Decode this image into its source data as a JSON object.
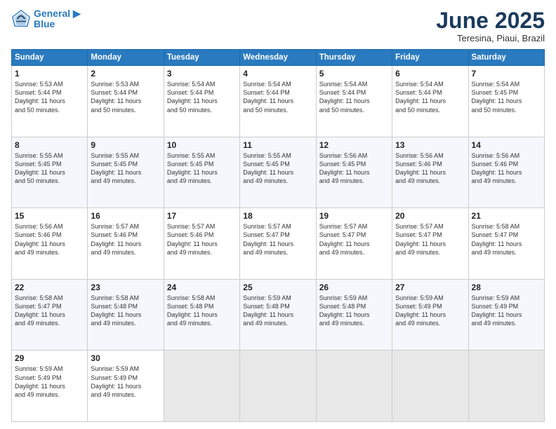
{
  "header": {
    "logo_line1": "General",
    "logo_line2": "Blue",
    "title": "June 2025",
    "subtitle": "Teresina, Piaui, Brazil"
  },
  "days_of_week": [
    "Sunday",
    "Monday",
    "Tuesday",
    "Wednesday",
    "Thursday",
    "Friday",
    "Saturday"
  ],
  "weeks": [
    [
      {
        "day": "1",
        "info": "Sunrise: 5:53 AM\nSunset: 5:44 PM\nDaylight: 11 hours\nand 50 minutes."
      },
      {
        "day": "2",
        "info": "Sunrise: 5:53 AM\nSunset: 5:44 PM\nDaylight: 11 hours\nand 50 minutes."
      },
      {
        "day": "3",
        "info": "Sunrise: 5:54 AM\nSunset: 5:44 PM\nDaylight: 11 hours\nand 50 minutes."
      },
      {
        "day": "4",
        "info": "Sunrise: 5:54 AM\nSunset: 5:44 PM\nDaylight: 11 hours\nand 50 minutes."
      },
      {
        "day": "5",
        "info": "Sunrise: 5:54 AM\nSunset: 5:44 PM\nDaylight: 11 hours\nand 50 minutes."
      },
      {
        "day": "6",
        "info": "Sunrise: 5:54 AM\nSunset: 5:44 PM\nDaylight: 11 hours\nand 50 minutes."
      },
      {
        "day": "7",
        "info": "Sunrise: 5:54 AM\nSunset: 5:45 PM\nDaylight: 11 hours\nand 50 minutes."
      }
    ],
    [
      {
        "day": "8",
        "info": "Sunrise: 5:55 AM\nSunset: 5:45 PM\nDaylight: 11 hours\nand 50 minutes."
      },
      {
        "day": "9",
        "info": "Sunrise: 5:55 AM\nSunset: 5:45 PM\nDaylight: 11 hours\nand 49 minutes."
      },
      {
        "day": "10",
        "info": "Sunrise: 5:55 AM\nSunset: 5:45 PM\nDaylight: 11 hours\nand 49 minutes."
      },
      {
        "day": "11",
        "info": "Sunrise: 5:55 AM\nSunset: 5:45 PM\nDaylight: 11 hours\nand 49 minutes."
      },
      {
        "day": "12",
        "info": "Sunrise: 5:56 AM\nSunset: 5:45 PM\nDaylight: 11 hours\nand 49 minutes."
      },
      {
        "day": "13",
        "info": "Sunrise: 5:56 AM\nSunset: 5:46 PM\nDaylight: 11 hours\nand 49 minutes."
      },
      {
        "day": "14",
        "info": "Sunrise: 5:56 AM\nSunset: 5:46 PM\nDaylight: 11 hours\nand 49 minutes."
      }
    ],
    [
      {
        "day": "15",
        "info": "Sunrise: 5:56 AM\nSunset: 5:46 PM\nDaylight: 11 hours\nand 49 minutes."
      },
      {
        "day": "16",
        "info": "Sunrise: 5:57 AM\nSunset: 5:46 PM\nDaylight: 11 hours\nand 49 minutes."
      },
      {
        "day": "17",
        "info": "Sunrise: 5:57 AM\nSunset: 5:46 PM\nDaylight: 11 hours\nand 49 minutes."
      },
      {
        "day": "18",
        "info": "Sunrise: 5:57 AM\nSunset: 5:47 PM\nDaylight: 11 hours\nand 49 minutes."
      },
      {
        "day": "19",
        "info": "Sunrise: 5:57 AM\nSunset: 5:47 PM\nDaylight: 11 hours\nand 49 minutes."
      },
      {
        "day": "20",
        "info": "Sunrise: 5:57 AM\nSunset: 5:47 PM\nDaylight: 11 hours\nand 49 minutes."
      },
      {
        "day": "21",
        "info": "Sunrise: 5:58 AM\nSunset: 5:47 PM\nDaylight: 11 hours\nand 49 minutes."
      }
    ],
    [
      {
        "day": "22",
        "info": "Sunrise: 5:58 AM\nSunset: 5:47 PM\nDaylight: 11 hours\nand 49 minutes."
      },
      {
        "day": "23",
        "info": "Sunrise: 5:58 AM\nSunset: 5:48 PM\nDaylight: 11 hours\nand 49 minutes."
      },
      {
        "day": "24",
        "info": "Sunrise: 5:58 AM\nSunset: 5:48 PM\nDaylight: 11 hours\nand 49 minutes."
      },
      {
        "day": "25",
        "info": "Sunrise: 5:59 AM\nSunset: 5:48 PM\nDaylight: 11 hours\nand 49 minutes."
      },
      {
        "day": "26",
        "info": "Sunrise: 5:59 AM\nSunset: 5:48 PM\nDaylight: 11 hours\nand 49 minutes."
      },
      {
        "day": "27",
        "info": "Sunrise: 5:59 AM\nSunset: 5:49 PM\nDaylight: 11 hours\nand 49 minutes."
      },
      {
        "day": "28",
        "info": "Sunrise: 5:59 AM\nSunset: 5:49 PM\nDaylight: 11 hours\nand 49 minutes."
      }
    ],
    [
      {
        "day": "29",
        "info": "Sunrise: 5:59 AM\nSunset: 5:49 PM\nDaylight: 11 hours\nand 49 minutes."
      },
      {
        "day": "30",
        "info": "Sunrise: 5:59 AM\nSunset: 5:49 PM\nDaylight: 11 hours\nand 49 minutes."
      },
      {
        "day": "",
        "info": ""
      },
      {
        "day": "",
        "info": ""
      },
      {
        "day": "",
        "info": ""
      },
      {
        "day": "",
        "info": ""
      },
      {
        "day": "",
        "info": ""
      }
    ]
  ]
}
